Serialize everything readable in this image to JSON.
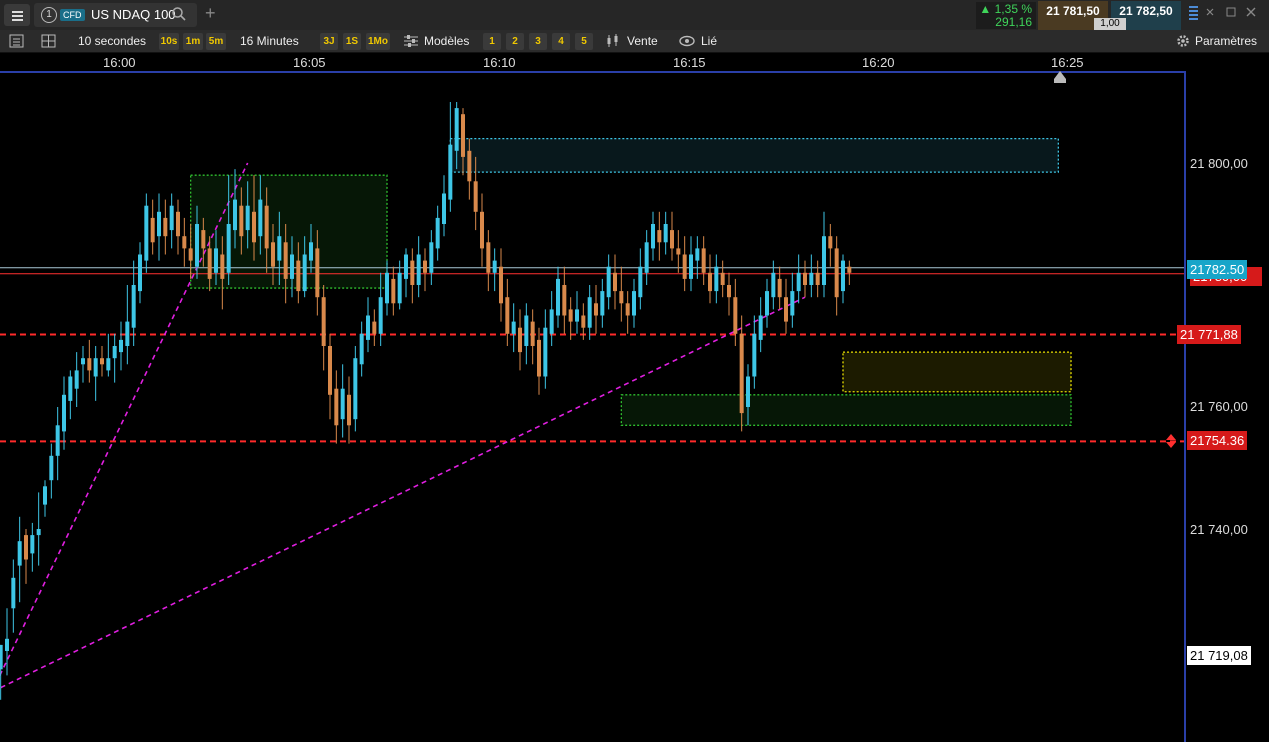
{
  "topbar": {
    "tab_number": "1",
    "tab_badge": "CFD",
    "instrument": "US NDAQ 100",
    "change_pct": "▲ 1,35 %",
    "change_pts": "291,16",
    "bid": "21 781,50",
    "ask": "21 782,50",
    "quantity": "1,00"
  },
  "toolbar": {
    "interval": "10 secondes",
    "interval_buttons": [
      "10s",
      "1m",
      "5m"
    ],
    "range": "16 Minutes",
    "range_buttons": [
      "3J",
      "1S",
      "1Mo"
    ],
    "models": "Modèles",
    "layout_buttons": [
      "1",
      "2",
      "3",
      "4",
      "5"
    ],
    "sell": "Vente",
    "linked": "Lié",
    "settings": "Paramètres"
  },
  "colors": {
    "up": "#3ec6e6",
    "down": "#d9894b",
    "level_red": "#ff2a2a",
    "trend": "#e01fe0",
    "axis_blue": "#2a3fa8"
  },
  "chart_data": {
    "type": "candlestick",
    "x_ticks": [
      "16:00",
      "16:05",
      "16:10",
      "16:15",
      "16:20",
      "16:25"
    ],
    "y_ticks": [
      "21 800,00",
      "21 760,00",
      "21 740,00"
    ],
    "ylim": [
      21712,
      21822
    ],
    "price_tags": {
      "last_cyan": "21782.50",
      "last_red": "21780,00",
      "level_1": "21 771,88",
      "level_2": "21754.36",
      "low": "21 719,08"
    },
    "levels": [
      21771.88,
      21754.36
    ],
    "last_price": 21782.5,
    "zones": [
      {
        "name": "resistance-zone",
        "color": "#3ec6e6",
        "t0": "16:08:40",
        "t1": "16:24:40",
        "p_top": 21804,
        "p_bot": 21798.5
      },
      {
        "name": "consolidation-zone",
        "color": "#2fbf2f",
        "t0": "16:01:50",
        "t1": "16:07:00",
        "p_top": 21798,
        "p_bot": 21779.5
      },
      {
        "name": "yellow-zone",
        "color": "#e8e000",
        "t0": "16:19:00",
        "t1": "16:25:00",
        "p_top": 21769,
        "p_bot": 21762.5
      },
      {
        "name": "support-zone",
        "color": "#2fbf2f",
        "t0": "16:13:10",
        "t1": "16:25:00",
        "p_top": 21762,
        "p_bot": 21757
      }
    ],
    "trendlines": [
      {
        "name": "steep-trendline",
        "t0": "15:56:30",
        "p0": 21712,
        "t1": "16:03:20",
        "p1": 21800
      },
      {
        "name": "shallow-trendline",
        "t0": "15:56:50",
        "p0": 21714,
        "t1": "16:18:00",
        "p1": 21778
      }
    ],
    "candles": [
      [
        21725,
        21728,
        21716,
        21730
      ],
      [
        21723,
        21725,
        21717,
        21719
      ],
      [
        21720,
        21722,
        21711,
        21718
      ],
      [
        21718,
        21723,
        21714,
        21715
      ],
      [
        21717,
        21721,
        21712,
        21721
      ],
      [
        21720,
        21722,
        21716,
        21727
      ],
      [
        21727,
        21732,
        21723,
        21735
      ],
      [
        21734,
        21738,
        21728,
        21742
      ],
      [
        21739,
        21735,
        21731,
        21740
      ],
      [
        21736,
        21739,
        21733,
        21741
      ],
      [
        21739,
        21740,
        21734,
        21746
      ],
      [
        21744,
        21747,
        21742,
        21748
      ],
      [
        21748,
        21752,
        21745,
        21754
      ],
      [
        21752,
        21757,
        21748,
        21760
      ],
      [
        21756,
        21762,
        21753,
        21765
      ],
      [
        21761,
        21765,
        21758,
        21766
      ],
      [
        21763,
        21766,
        21760,
        21769
      ],
      [
        21767,
        21768,
        21764,
        21770
      ],
      [
        21768,
        21766,
        21764,
        21771
      ],
      [
        21765,
        21768,
        21761,
        21770
      ],
      [
        21768,
        21767,
        21765,
        21770
      ],
      [
        21766,
        21768,
        21765,
        21772
      ],
      [
        21768,
        21770,
        21764,
        21772
      ],
      [
        21769,
        21771,
        21766,
        21774
      ],
      [
        21770,
        21774,
        21767,
        21780
      ],
      [
        21773,
        21780,
        21770,
        21784
      ],
      [
        21779,
        21785,
        21777,
        21787
      ],
      [
        21784,
        21793,
        21782,
        21795
      ],
      [
        21791,
        21787,
        21785,
        21794
      ],
      [
        21788,
        21792,
        21784,
        21795
      ],
      [
        21791,
        21788,
        21785,
        21794
      ],
      [
        21789,
        21793,
        21786,
        21795
      ],
      [
        21792,
        21788,
        21785,
        21794
      ],
      [
        21788,
        21786,
        21783,
        21791
      ],
      [
        21786,
        21784,
        21781,
        21790
      ],
      [
        21783,
        21790,
        21781,
        21793
      ],
      [
        21789,
        21786,
        21783,
        21791
      ],
      [
        21786,
        21781,
        21779,
        21788
      ],
      [
        21782,
        21786,
        21780,
        21789
      ],
      [
        21785,
        21781,
        21776,
        21788
      ],
      [
        21782,
        21790,
        21780,
        21798
      ],
      [
        21789,
        21794,
        21786,
        21799
      ],
      [
        21793,
        21788,
        21785,
        21796
      ],
      [
        21789,
        21793,
        21786,
        21797
      ],
      [
        21792,
        21787,
        21784,
        21798
      ],
      [
        21788,
        21794,
        21785,
        21798
      ],
      [
        21793,
        21786,
        21782,
        21796
      ],
      [
        21787,
        21783,
        21780,
        21790
      ],
      [
        21784,
        21788,
        21780,
        21792
      ],
      [
        21787,
        21781,
        21777,
        21790
      ],
      [
        21781,
        21785,
        21778,
        21788
      ],
      [
        21784,
        21779,
        21777,
        21787
      ],
      [
        21779,
        21785,
        21778,
        21788
      ],
      [
        21784,
        21787,
        21782,
        21790
      ],
      [
        21786,
        21778,
        21775,
        21789
      ],
      [
        21778,
        21770,
        21766,
        21780
      ],
      [
        21770,
        21762,
        21758,
        21772
      ],
      [
        21763,
        21757,
        21754,
        21766
      ],
      [
        21758,
        21763,
        21755,
        21767
      ],
      [
        21762,
        21757,
        21754,
        21765
      ],
      [
        21758,
        21768,
        21756,
        21770
      ],
      [
        21767,
        21772,
        21765,
        21774
      ],
      [
        21771,
        21775,
        21769,
        21778
      ],
      [
        21774,
        21772,
        21770,
        21776
      ],
      [
        21772,
        21778,
        21770,
        21782
      ],
      [
        21777,
        21782,
        21775,
        21784
      ],
      [
        21781,
        21777,
        21775,
        21783
      ],
      [
        21777,
        21782,
        21776,
        21784
      ],
      [
        21781,
        21785,
        21778,
        21786
      ],
      [
        21784,
        21780,
        21777,
        21786
      ],
      [
        21780,
        21785,
        21778,
        21788
      ],
      [
        21784,
        21782,
        21779,
        21786
      ],
      [
        21782,
        21787,
        21780,
        21789
      ],
      [
        21786,
        21791,
        21784,
        21793
      ],
      [
        21790,
        21795,
        21788,
        21798
      ],
      [
        21794,
        21803,
        21792,
        21810
      ],
      [
        21802,
        21809,
        21799,
        21810
      ],
      [
        21808,
        21801,
        21798,
        21809
      ],
      [
        21802,
        21797,
        21794,
        21804
      ],
      [
        21797,
        21792,
        21789,
        21801
      ],
      [
        21792,
        21786,
        21783,
        21795
      ],
      [
        21787,
        21782,
        21779,
        21789
      ],
      [
        21782,
        21784,
        21779,
        21786
      ],
      [
        21783,
        21777,
        21774,
        21786
      ],
      [
        21778,
        21772,
        21770,
        21781
      ],
      [
        21772,
        21774,
        21769,
        21777
      ],
      [
        21773,
        21769,
        21766,
        21776
      ],
      [
        21770,
        21775,
        21767,
        21777
      ],
      [
        21774,
        21770,
        21767,
        21776
      ],
      [
        21771,
        21765,
        21762,
        21773
      ],
      [
        21765,
        21773,
        21763,
        21776
      ],
      [
        21772,
        21776,
        21770,
        21779
      ],
      [
        21775,
        21781,
        21773,
        21783
      ],
      [
        21780,
        21775,
        21772,
        21783
      ],
      [
        21776,
        21774,
        21771,
        21778
      ],
      [
        21774,
        21776,
        21772,
        21779
      ],
      [
        21775,
        21773,
        21771,
        21777
      ],
      [
        21773,
        21778,
        21771,
        21780
      ],
      [
        21777,
        21775,
        21772,
        21780
      ],
      [
        21775,
        21779,
        21773,
        21781
      ],
      [
        21778,
        21783,
        21776,
        21785
      ],
      [
        21782,
        21779,
        21776,
        21785
      ],
      [
        21779,
        21777,
        21774,
        21783
      ],
      [
        21777,
        21775,
        21772,
        21779
      ],
      [
        21775,
        21779,
        21773,
        21781
      ],
      [
        21778,
        21783,
        21776,
        21786
      ],
      [
        21782,
        21787,
        21780,
        21789
      ],
      [
        21786,
        21790,
        21784,
        21792
      ],
      [
        21789,
        21787,
        21784,
        21792
      ],
      [
        21787,
        21790,
        21785,
        21792
      ],
      [
        21789,
        21786,
        21784,
        21792
      ],
      [
        21786,
        21785,
        21782,
        21789
      ],
      [
        21785,
        21781,
        21779,
        21788
      ],
      [
        21781,
        21785,
        21779,
        21788
      ],
      [
        21784,
        21786,
        21781,
        21788
      ],
      [
        21786,
        21782,
        21780,
        21788
      ],
      [
        21782,
        21779,
        21777,
        21785
      ],
      [
        21779,
        21783,
        21777,
        21785
      ],
      [
        21782,
        21780,
        21778,
        21784
      ],
      [
        21780,
        21778,
        21775,
        21782
      ],
      [
        21778,
        21772,
        21770,
        21781
      ],
      [
        21772,
        21759,
        21756,
        21775
      ],
      [
        21760,
        21765,
        21757,
        21767
      ],
      [
        21765,
        21772,
        21763,
        21775
      ],
      [
        21771,
        21775,
        21769,
        21778
      ],
      [
        21775,
        21779,
        21773,
        21781
      ],
      [
        21778,
        21782,
        21776,
        21784
      ],
      [
        21781,
        21778,
        21776,
        21783
      ],
      [
        21778,
        21774,
        21772,
        21781
      ],
      [
        21775,
        21779,
        21773,
        21782
      ],
      [
        21779,
        21782,
        21777,
        21785
      ],
      [
        21782,
        21780,
        21778,
        21784
      ],
      [
        21780,
        21782,
        21778,
        21785
      ],
      [
        21782,
        21780,
        21778,
        21784
      ],
      [
        21780,
        21788,
        21778,
        21792
      ],
      [
        21788,
        21786,
        21783,
        21790
      ],
      [
        21786,
        21778,
        21775,
        21788
      ],
      [
        21779,
        21784,
        21777,
        21785
      ],
      [
        21783,
        21782,
        21780,
        21784
      ]
    ]
  }
}
